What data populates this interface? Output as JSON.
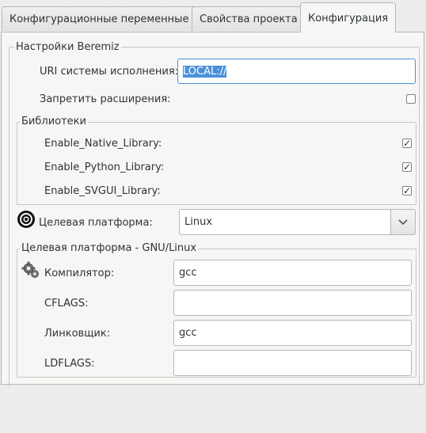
{
  "tabs": [
    {
      "label": "Конфигурационные переменные",
      "active": false
    },
    {
      "label": "Свойства проекта",
      "active": false
    },
    {
      "label": "Конфигурация",
      "active": true
    }
  ],
  "beremiz_settings": {
    "title": "Настройки Beremiz",
    "uri_label": "URI системы исполнения:",
    "uri_value": "LOCAL://",
    "disable_extensions_label": "Запретить расширения:",
    "disable_extensions_checked": false
  },
  "libraries": {
    "title": "Библиотеки",
    "items": [
      {
        "label": "Enable_Native_Library:",
        "checked": true
      },
      {
        "label": "Enable_Python_Library:",
        "checked": true
      },
      {
        "label": "Enable_SVGUI_Library:",
        "checked": true
      }
    ]
  },
  "target": {
    "label": "Целевая платформа:",
    "value": "Linux",
    "icon": "target-icon"
  },
  "gnu_linux": {
    "title": "Целевая платформа - GNU/Linux",
    "compiler_label": "Компилятор:",
    "compiler_value": "gcc",
    "compiler_icon": "gears-icon",
    "cflags_label": "CFLAGS:",
    "cflags_value": "",
    "linker_label": "Линковщик:",
    "linker_value": "gcc",
    "ldflags_label": "LDFLAGS:",
    "ldflags_value": ""
  },
  "colors": {
    "selection": "#4a90d9",
    "background": "#ededed",
    "panel": "#f6f6f5",
    "border": "#b6b6b3"
  }
}
